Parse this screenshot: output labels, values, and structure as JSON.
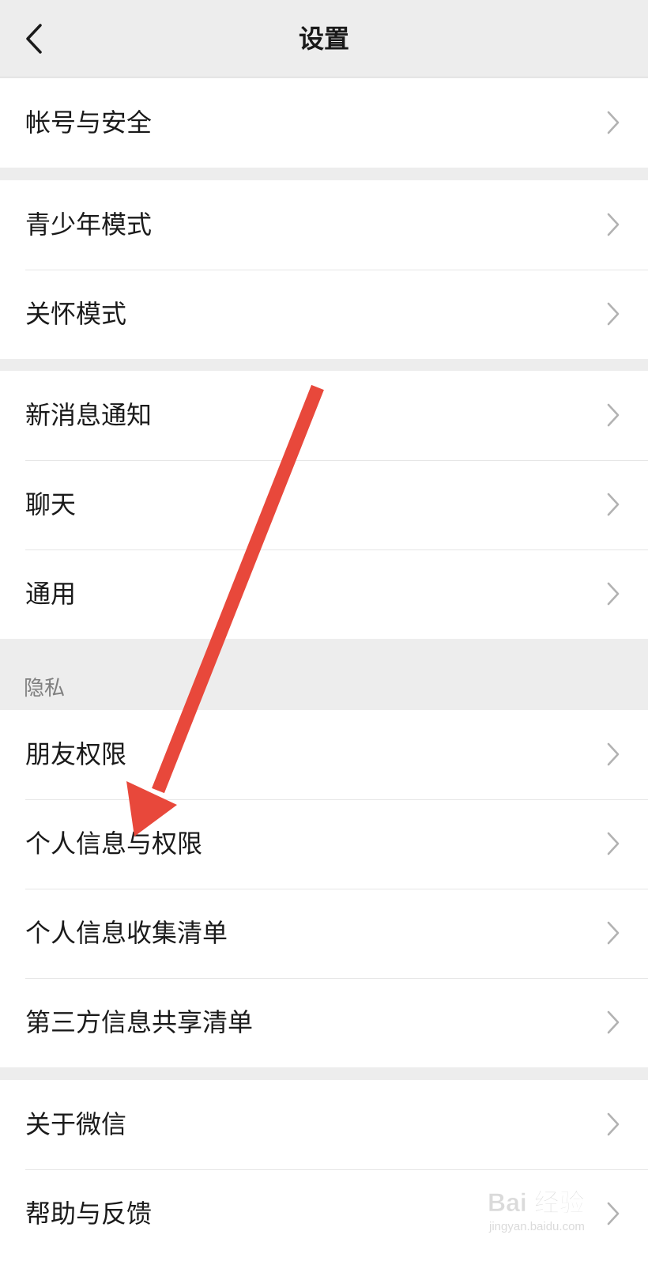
{
  "nav": {
    "title": "设置",
    "back_icon": "chevron-left-icon"
  },
  "groups": [
    {
      "items": [
        {
          "label": "帐号与安全"
        }
      ]
    },
    {
      "items": [
        {
          "label": "青少年模式"
        },
        {
          "label": "关怀模式"
        }
      ]
    },
    {
      "items": [
        {
          "label": "新消息通知"
        },
        {
          "label": "聊天"
        },
        {
          "label": "通用"
        }
      ]
    },
    {
      "section_title": "隐私",
      "items": [
        {
          "label": "朋友权限"
        },
        {
          "label": "个人信息与权限"
        },
        {
          "label": "个人信息收集清单"
        },
        {
          "label": "第三方信息共享清单"
        }
      ]
    },
    {
      "items": [
        {
          "label": "关于微信"
        },
        {
          "label": "帮助与反馈"
        }
      ]
    }
  ],
  "colors": {
    "background": "#ededed",
    "cell": "#ffffff",
    "text": "#1a1a1a",
    "secondary_text": "#7f7f7f",
    "chevron": "#b2b2b2",
    "annotation_arrow": "#e8483b"
  },
  "item_icon": "chevron-right-icon",
  "watermark": {
    "text": "Bai 经验",
    "subtext": "jingyan.baidu.com"
  }
}
